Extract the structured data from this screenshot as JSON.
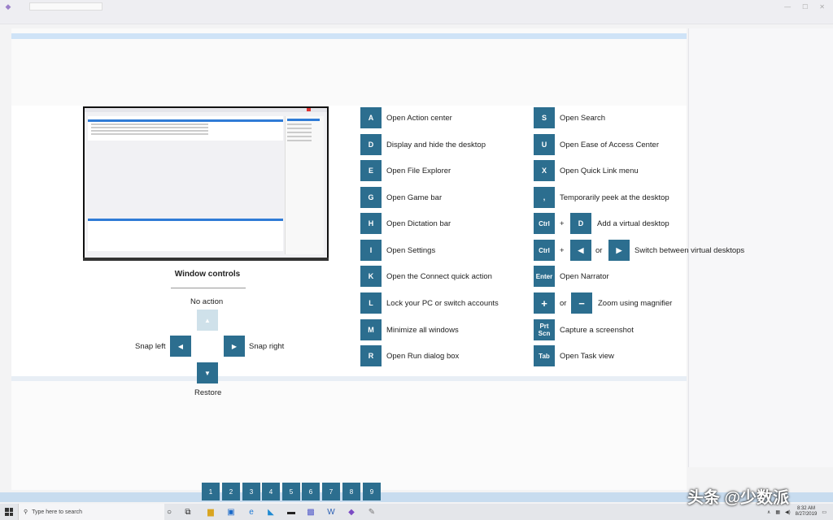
{
  "window_controls": {
    "title": "Window controls",
    "no_action": "No action",
    "snap_left": "Snap left",
    "snap_right": "Snap right",
    "restore": "Restore"
  },
  "shortcuts_left": [
    {
      "key": "A",
      "label": "Open Action center"
    },
    {
      "key": "D",
      "label": "Display and hide the desktop"
    },
    {
      "key": "E",
      "label": "Open File Explorer"
    },
    {
      "key": "G",
      "label": "Open Game bar"
    },
    {
      "key": "H",
      "label": "Open Dictation bar"
    },
    {
      "key": "I",
      "label": "Open Settings"
    },
    {
      "key": "K",
      "label": "Open the Connect quick action"
    },
    {
      "key": "L",
      "label": "Lock your PC or switch accounts"
    },
    {
      "key": "M",
      "label": "Minimize all windows"
    },
    {
      "key": "R",
      "label": "Open Run dialog box"
    }
  ],
  "shortcuts_right": {
    "s": {
      "key": "S",
      "label": "Open Search"
    },
    "u": {
      "key": "U",
      "label": "Open Ease of Access Center"
    },
    "x": {
      "key": "X",
      "label": "Open Quick Link menu"
    },
    "comma": {
      "key": ",",
      "label": "Temporarily peek at the desktop"
    },
    "add_desktop": {
      "key1": "Ctrl",
      "plus": "+",
      "key2": "D",
      "label": "Add a virtual desktop"
    },
    "switch_desktop": {
      "key1": "Ctrl",
      "plus": "+",
      "or": "or",
      "label": "Switch between virtual desktops"
    },
    "enter": {
      "key": "Enter",
      "label": "Open Narrator"
    },
    "zoom": {
      "key1": "+",
      "or": "or",
      "key2": "−",
      "label": "Zoom using magnifier"
    },
    "prtscn": {
      "key_line1": "Prt",
      "key_line2": "Scn",
      "label": "Capture a screenshot"
    },
    "tab": {
      "key": "Tab",
      "label": "Open Task view"
    }
  },
  "taskbar_numbers": [
    "1",
    "2",
    "3",
    "4",
    "5",
    "6",
    "7",
    "8",
    "9"
  ],
  "taskbar": {
    "search_placeholder": "Type here to search",
    "time": "8:32 AM",
    "date": "8/27/2019"
  },
  "watermark": "头条 @少数派",
  "colors": {
    "key_bg": "#2c6e8f",
    "overlay_bg": "#ffffff",
    "taskbar_bg": "#e4e6ea"
  }
}
